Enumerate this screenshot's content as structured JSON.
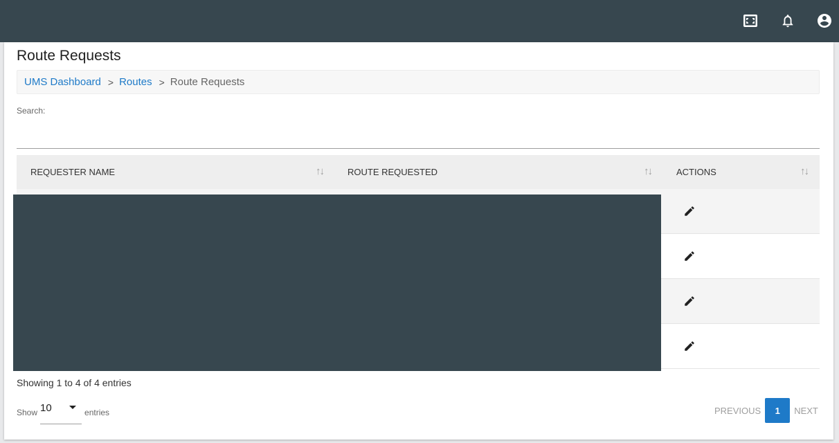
{
  "topbar": {
    "icons": [
      "fullscreen-icon",
      "bell-icon",
      "account-circle-icon"
    ],
    "bg_color": "#37474f"
  },
  "page": {
    "title": "Route Requests"
  },
  "breadcrumb": {
    "items": [
      {
        "label": "UMS Dashboard",
        "link": true
      },
      {
        "label": "Routes",
        "link": true
      },
      {
        "label": "Route Requests",
        "link": false
      }
    ],
    "link_color": "#1e7ac8"
  },
  "search": {
    "label": "Search:",
    "value": "",
    "placeholder": ""
  },
  "table": {
    "columns": [
      "REQUESTER NAME",
      "ROUTE REQUESTED",
      "ACTIONS"
    ],
    "sort_icon": "sort-arrows-icon",
    "rows": [
      {
        "requester_name": "",
        "route_requested": "",
        "action": "edit-icon"
      },
      {
        "requester_name": "",
        "route_requested": "",
        "action": "edit-icon"
      },
      {
        "requester_name": "",
        "route_requested": "",
        "action": "edit-icon"
      },
      {
        "requester_name": "",
        "route_requested": "",
        "action": "edit-icon"
      }
    ]
  },
  "footer": {
    "showing": "Showing 1 to 4 of 4 entries",
    "length": {
      "show_label": "Show",
      "value": "10",
      "entries_label": "entries"
    },
    "pagination": {
      "previous": "PREVIOUS",
      "current": "1",
      "next": "NEXT",
      "active_color": "#1e7ac8"
    }
  }
}
